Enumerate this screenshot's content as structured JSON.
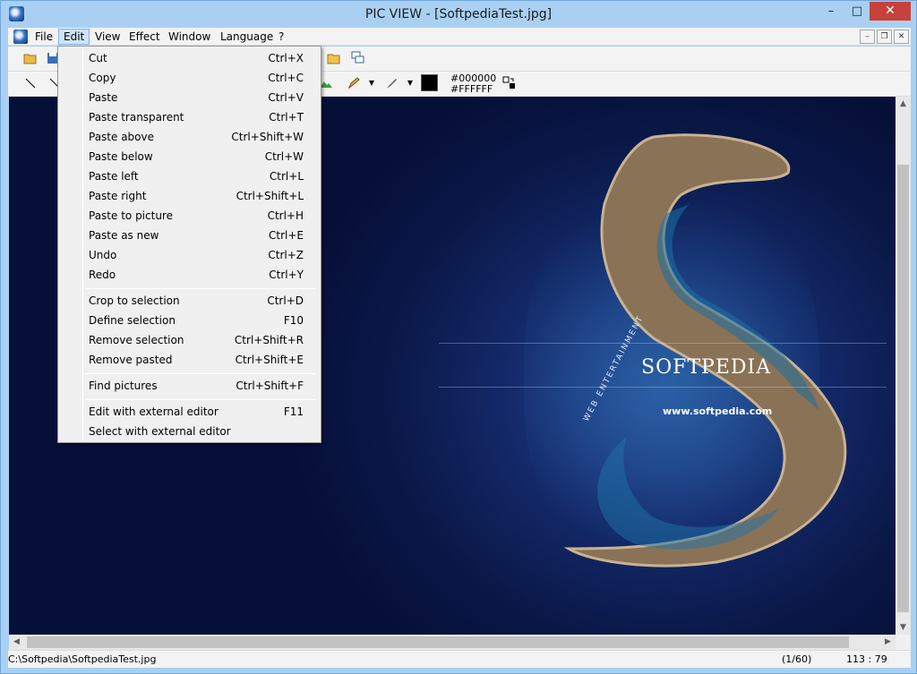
{
  "window": {
    "title": "PIC VIEW  - [SoftpediaTest.jpg]",
    "controls": {
      "minimize": "–",
      "maximize": "□",
      "close": "✕"
    }
  },
  "menubar": {
    "items": [
      {
        "label": "File"
      },
      {
        "label": "Edit"
      },
      {
        "label": "View"
      },
      {
        "label": "Effect"
      },
      {
        "label": "Window"
      },
      {
        "label": "Language"
      },
      {
        "label": "?"
      }
    ],
    "mdi_controls": {
      "minimize": "–",
      "restore": "❐",
      "close": "✕"
    }
  },
  "toolbar2": {
    "color_fg": "#000000",
    "color_bg": "#FFFFFF",
    "swatch_color": "#000000"
  },
  "edit_menu": {
    "groups": [
      [
        {
          "label": "Cut",
          "shortcut": "Ctrl+X"
        },
        {
          "label": "Copy",
          "shortcut": "Ctrl+C"
        },
        {
          "label": "Paste",
          "shortcut": "Ctrl+V"
        },
        {
          "label": "Paste transparent",
          "shortcut": "Ctrl+T"
        },
        {
          "label": "Paste above",
          "shortcut": "Ctrl+Shift+W"
        },
        {
          "label": "Paste below",
          "shortcut": "Ctrl+W"
        },
        {
          "label": "Paste left",
          "shortcut": "Ctrl+L"
        },
        {
          "label": "Paste right",
          "shortcut": "Ctrl+Shift+L"
        },
        {
          "label": "Paste to picture",
          "shortcut": "Ctrl+H"
        },
        {
          "label": "Paste as new",
          "shortcut": "Ctrl+E"
        },
        {
          "label": "Undo",
          "shortcut": "Ctrl+Z"
        },
        {
          "label": "Redo",
          "shortcut": "Ctrl+Y"
        }
      ],
      [
        {
          "label": "Crop to selection",
          "shortcut": "Ctrl+D"
        },
        {
          "label": "Define selection",
          "shortcut": "F10"
        },
        {
          "label": "Remove selection",
          "shortcut": "Ctrl+Shift+R"
        },
        {
          "label": "Remove pasted",
          "shortcut": "Ctrl+Shift+E"
        }
      ],
      [
        {
          "label": "Find pictures",
          "shortcut": "Ctrl+Shift+F"
        }
      ],
      [
        {
          "label": "Edit with external editor",
          "shortcut": "F11"
        },
        {
          "label": "Select with external editor",
          "shortcut": ""
        }
      ]
    ]
  },
  "image": {
    "logo_text": "SOFTPEDIA",
    "url_text": "www.softpedia.com",
    "tagline": "WEB ENTERTAINMENT"
  },
  "statusbar": {
    "path": "C:\\Softpedia\\SoftpediaTest.jpg",
    "count": "(1/60)",
    "coords": "113 : 79"
  },
  "colors": {
    "titlebar": "#a9d0f2",
    "close_button": "#c7413b",
    "menu_highlight": "#cde4f7"
  }
}
